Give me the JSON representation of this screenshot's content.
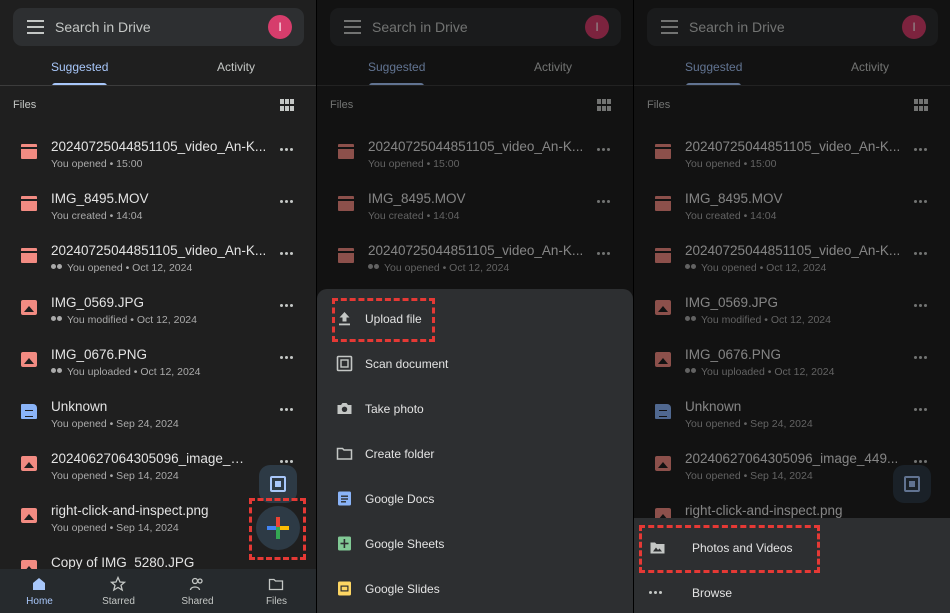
{
  "search_placeholder": "Search in Drive",
  "avatar_initial": "I",
  "tabs": [
    "Suggested",
    "Activity"
  ],
  "files_label": "Files",
  "files": [
    {
      "name": "20240725044851105_video_An-K...",
      "sub": "You opened • 15:00",
      "icon": "video",
      "shared": false
    },
    {
      "name": "IMG_8495.MOV",
      "sub": "You created • 14:04",
      "icon": "video",
      "shared": false
    },
    {
      "name": "20240725044851105_video_An-K...",
      "sub": "You opened • Oct 12, 2024",
      "icon": "video",
      "shared": true
    },
    {
      "name": "IMG_0569.JPG",
      "sub": "You modified • Oct 12, 2024",
      "icon": "image",
      "shared": true
    },
    {
      "name": "IMG_0676.PNG",
      "sub": "You uploaded • Oct 12, 2024",
      "icon": "image",
      "shared": true
    },
    {
      "name": "Unknown",
      "sub": "You opened • Sep 24, 2024",
      "icon": "doc",
      "shared": false
    },
    {
      "name": "20240627064305096_image_449...",
      "sub": "You opened • Sep 14, 2024",
      "icon": "image",
      "shared": false
    },
    {
      "name": "right-click-and-inspect.png",
      "sub": "You opened • Sep 14, 2024",
      "icon": "image",
      "shared": false
    },
    {
      "name": "Copy of IMG_5280.JPG",
      "sub": "",
      "icon": "image",
      "shared": false
    }
  ],
  "nav": [
    "Home",
    "Starred",
    "Shared",
    "Files"
  ],
  "new_menu": [
    "Upload file",
    "Scan document",
    "Take photo",
    "Create folder",
    "Google Docs",
    "Google Sheets",
    "Google Slides"
  ],
  "upload_menu": [
    "Photos and Videos",
    "Browse"
  ],
  "colors": {
    "accent": "#a8c7fa",
    "highlight": "#e53935",
    "media_icon": "#f28b82",
    "doc_icon": "#8ab4f8"
  }
}
